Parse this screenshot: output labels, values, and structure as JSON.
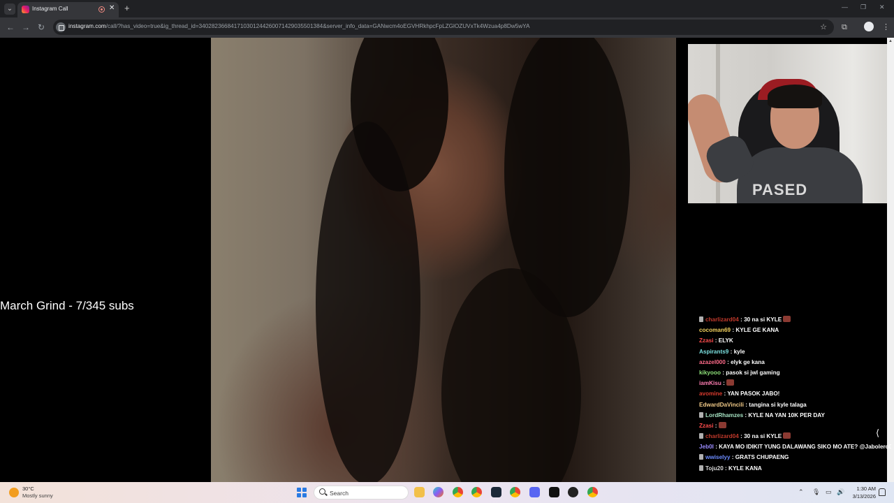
{
  "browser": {
    "tab_title": "Instagram Call",
    "tab_close": "✕",
    "new_tab": "+",
    "url_host": "instagram.com",
    "url_path": "/call/?has_video=true&ig_thread_id=340282366841710301244260071429035501384&server_info_data=GANwcm4oEGVHRkhpcFpLZGlOZUVxTk4Wzua4p8Dw5wYA",
    "icons": [
      "tab-search-icon",
      "instagram-favicon",
      "recording-icon",
      "back-icon",
      "forward-icon",
      "reload-icon",
      "site-info-icon",
      "bookmark-star-icon",
      "extensions-icon",
      "profile-icon",
      "kebab-menu-icon",
      "minimize-icon",
      "maximize-icon",
      "close-window-icon"
    ]
  },
  "overlay": {
    "grind_text": "March Grind - 7/345 subs"
  },
  "chat": {
    "messages": [
      {
        "user": "charlizard04",
        "text": " : 30 na si KYLE",
        "color": "#c0392b",
        "badge": true,
        "emote": true
      },
      {
        "user": "cocoman69",
        "text": " : KYLE GE KANA",
        "color": "#f4d35e",
        "badge": false,
        "emote": false
      },
      {
        "user": "Zzasi",
        "text": " : ELYK",
        "color": "#ff4d4d",
        "badge": false,
        "emote": false
      },
      {
        "user": "Aspirants9",
        "text": " : kyle",
        "color": "#7be0e0",
        "badge": false,
        "emote": false
      },
      {
        "user": "azazel000",
        "text": " : elyk ge kana",
        "color": "#ff6b8a",
        "badge": false,
        "emote": false
      },
      {
        "user": "kikyooo",
        "text": " : pasok si jwl gaming",
        "color": "#8fe37a",
        "badge": false,
        "emote": false
      },
      {
        "user": "iamKisu",
        "text": " :",
        "color": "#ff7eb3",
        "badge": false,
        "emote": true
      },
      {
        "user": "avomine",
        "text": " : YAN PASOK JABO!",
        "color": "#d83b2f",
        "badge": false,
        "emote": false
      },
      {
        "user": "EdwardDaVincili",
        "text": " : tangina si kyle talaga",
        "color": "#f0c987",
        "badge": false,
        "emote": false
      },
      {
        "user": "LordRhamzes",
        "text": " : KYLE NA YAN 10K PER DAY",
        "color": "#a6e3c3",
        "badge": true,
        "emote": false
      },
      {
        "user": "Zzasi",
        "text": " :",
        "color": "#ff4d4d",
        "badge": false,
        "emote": true
      },
      {
        "user": "charlizard04",
        "text": " : 30 na si KYLE",
        "color": "#c0392b",
        "badge": true,
        "emote": true
      },
      {
        "user": "Jeb0l",
        "text": " : KAYA MO IDIKIT YUNG DALAWANG SIKO MO ATE? @JaboleroDota",
        "color": "#9b8cff",
        "badge": false,
        "emote": false
      },
      {
        "user": "wwiselyy",
        "text": " : GRATS CHUPAENG",
        "color": "#6c8cff",
        "badge": true,
        "emote": false
      },
      {
        "user": "Toju20",
        "text": " : KYLE KANA",
        "color": "#d9d9d9",
        "badge": true,
        "emote": false
      }
    ]
  },
  "taskbar": {
    "weather_temp": "30°C",
    "weather_desc": "Mostly sunny",
    "search_placeholder": "Search",
    "time": "1:30 AM",
    "date": "3/13/2026"
  },
  "colors": {
    "chrome_dark": "#202124",
    "chrome_toolbar": "#35363a",
    "windows_accent": "#2a7ae2"
  }
}
